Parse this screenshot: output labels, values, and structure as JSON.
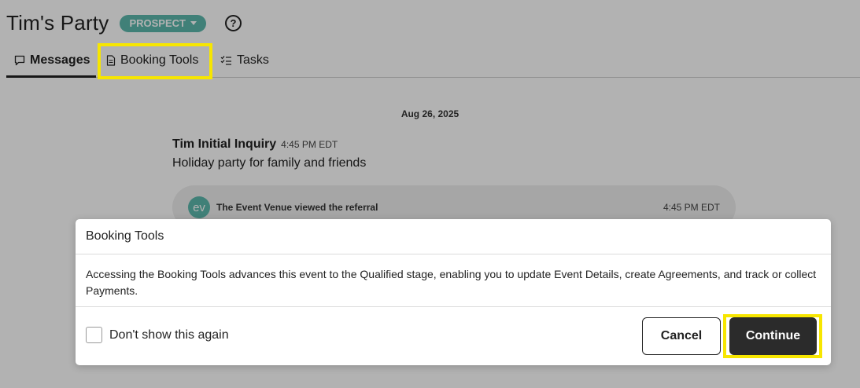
{
  "header": {
    "title": "Tim's Party",
    "status": "PROSPECT",
    "help_icon": "?"
  },
  "tabs": [
    {
      "label": "Messages",
      "icon": "chat-bubble-icon",
      "active": true
    },
    {
      "label": "Booking Tools",
      "icon": "document-icon",
      "active": false
    },
    {
      "label": "Tasks",
      "icon": "checklist-icon",
      "active": false
    }
  ],
  "feed": {
    "date": "Aug 26, 2025",
    "message": {
      "sender": "Tim Initial Inquiry",
      "time": "4:45 PM EDT",
      "body": "Holiday party for family and friends"
    },
    "activity": {
      "avatar": "ev",
      "text": "The Event Venue viewed the referral",
      "time": "4:45 PM EDT"
    }
  },
  "modal": {
    "title": "Booking Tools",
    "body": "Accessing the Booking Tools advances this event to the Qualified stage, enabling you to update Event Details, create Agreements, and track or collect Payments.",
    "checkbox_label": "Don't show this again",
    "checkbox_checked": false,
    "cancel_label": "Cancel",
    "continue_label": "Continue"
  },
  "colors": {
    "status_pill": "#5cb8ad",
    "highlight": "#f7e600",
    "primary_button": "#2b2b2b"
  }
}
